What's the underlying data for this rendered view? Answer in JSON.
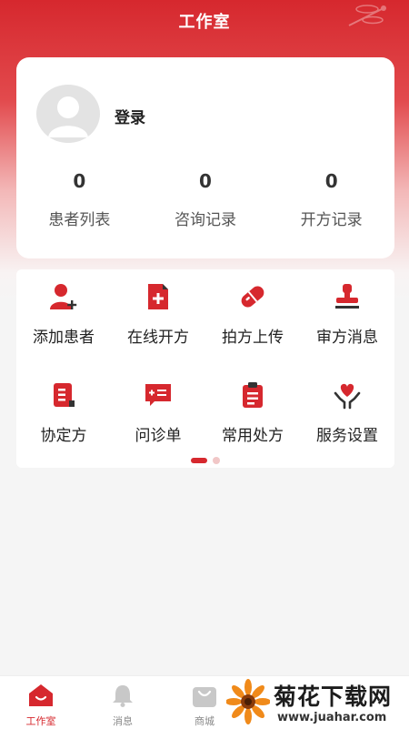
{
  "header": {
    "title": "工作室"
  },
  "profile": {
    "login_label": "登录",
    "stats": [
      {
        "value": "0",
        "label": "患者列表"
      },
      {
        "value": "0",
        "label": "咨询记录"
      },
      {
        "value": "0",
        "label": "开方记录"
      }
    ]
  },
  "grid": {
    "items": [
      {
        "label": "添加患者",
        "icon": "add-patient-icon"
      },
      {
        "label": "在线开方",
        "icon": "online-prescription-icon"
      },
      {
        "label": "拍方上传",
        "icon": "pill-upload-icon"
      },
      {
        "label": "审方消息",
        "icon": "stamp-icon"
      },
      {
        "label": "协定方",
        "icon": "agreed-prescription-icon"
      },
      {
        "label": "问诊单",
        "icon": "consultation-form-icon"
      },
      {
        "label": "常用处方",
        "icon": "clipboard-icon"
      },
      {
        "label": "服务设置",
        "icon": "heart-hand-icon"
      }
    ],
    "page_indicator": {
      "current": 1,
      "total": 2
    }
  },
  "tabbar": {
    "items": [
      {
        "label": "工作室",
        "icon": "home-icon",
        "active": true
      },
      {
        "label": "消息",
        "icon": "bell-icon",
        "active": false
      },
      {
        "label": "商城",
        "icon": "shop-bag-icon",
        "active": false
      }
    ]
  },
  "watermark": {
    "title": "菊花下载网",
    "url": "www.juahar.com"
  },
  "colors": {
    "accent": "#d6282e",
    "background": "#f5f5f5",
    "card": "#ffffff"
  }
}
